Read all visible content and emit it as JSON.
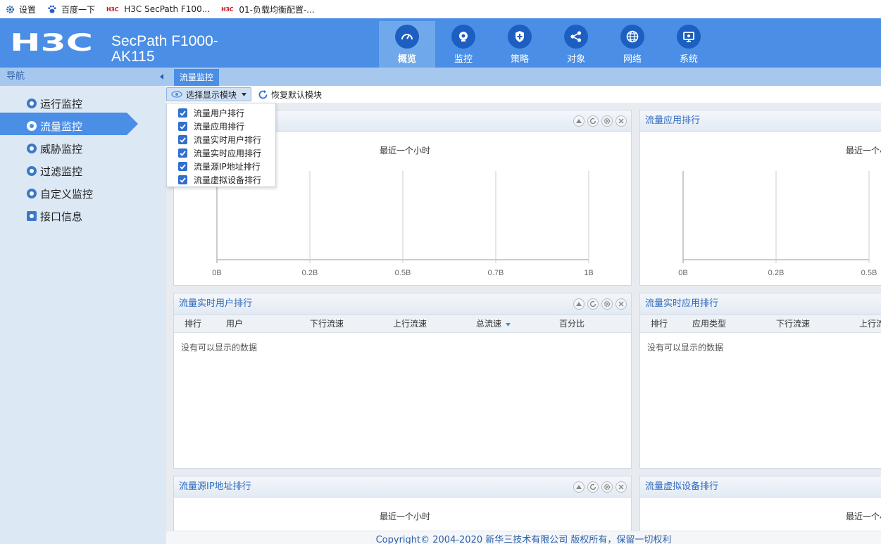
{
  "bookmarks": [
    {
      "label": "设置",
      "icon": "gear-icon"
    },
    {
      "label": "百度一下",
      "icon": "baidu-paw-icon"
    },
    {
      "label": "H3C SecPath F100...",
      "icon": "h3c-favicon"
    },
    {
      "label": "01-负载均衡配置-...",
      "icon": "h3c-favicon"
    }
  ],
  "h3c_mini": "H3C",
  "header": {
    "logo_text": "H3C",
    "product_line1": "SecPath F1000-",
    "product_line2": "AK115",
    "bg_color": "#4a8ee6",
    "nav": [
      {
        "label": "概览",
        "icon": "dashboard-gauge-icon",
        "active": true
      },
      {
        "label": "监控",
        "icon": "monitor-camera-icon"
      },
      {
        "label": "策略",
        "icon": "shield-icon"
      },
      {
        "label": "对象",
        "icon": "share-nodes-icon"
      },
      {
        "label": "网络",
        "icon": "globe-icon"
      },
      {
        "label": "系统",
        "icon": "system-screen-icon"
      }
    ]
  },
  "sidebar": {
    "title": "导航",
    "items": [
      {
        "label": "运行监控",
        "icon": "run-monitor-icon"
      },
      {
        "label": "流量监控",
        "icon": "traffic-monitor-icon",
        "active": true
      },
      {
        "label": "威胁监控",
        "icon": "threat-monitor-icon"
      },
      {
        "label": "过滤监控",
        "icon": "filter-monitor-icon"
      },
      {
        "label": "自定义监控",
        "icon": "custom-monitor-icon"
      },
      {
        "label": "接口信息",
        "icon": "interface-info-icon"
      }
    ]
  },
  "tabs": {
    "active": "流量监控"
  },
  "toolbar": {
    "select_module": "选择显示模块",
    "restore_default": "恢复默认模块"
  },
  "dropdown": {
    "items": [
      {
        "label": "流量用户排行",
        "checked": true
      },
      {
        "label": "流量应用排行",
        "checked": true
      },
      {
        "label": "流量实时用户排行",
        "checked": true
      },
      {
        "label": "流量实时应用排行",
        "checked": true
      },
      {
        "label": "流量源IP地址排行",
        "checked": true
      },
      {
        "label": "流量虚拟设备排行",
        "checked": true
      }
    ]
  },
  "panels": {
    "user_rank": {
      "caption": "最近一个小时"
    },
    "app_rank": {
      "title": "流量应用排行",
      "caption": "最近一个小"
    },
    "realtime_user": {
      "title": "流量实时用户排行",
      "columns": [
        "排行",
        "用户",
        "下行流速",
        "上行流速",
        "总流速",
        "百分比"
      ],
      "empty": "没有可以显示的数据"
    },
    "realtime_app": {
      "title": "流量实时应用排行",
      "columns": [
        "排行",
        "应用类型",
        "下行流速",
        "上行流"
      ],
      "empty": "没有可以显示的数据"
    },
    "src_ip": {
      "title": "流量源IP地址排行",
      "caption": "最近一个小时"
    },
    "vdev": {
      "title": "流量虚拟设备排行",
      "caption": "最近一个小"
    }
  },
  "chart_data": [
    {
      "type": "bar",
      "caption": "最近一个小时",
      "x_tick_labels": [
        "0B",
        "0.2B",
        "0.5B",
        "0.7B",
        "1B"
      ],
      "categories": [],
      "values": []
    },
    {
      "type": "bar",
      "caption": "最近一个小",
      "x_tick_labels": [
        "0B",
        "0.2B",
        "0.5B"
      ],
      "categories": [],
      "values": []
    }
  ],
  "footer": {
    "text": "Copyright© 2004-2020 新华三技术有限公司 版权所有，保留一切权利"
  }
}
